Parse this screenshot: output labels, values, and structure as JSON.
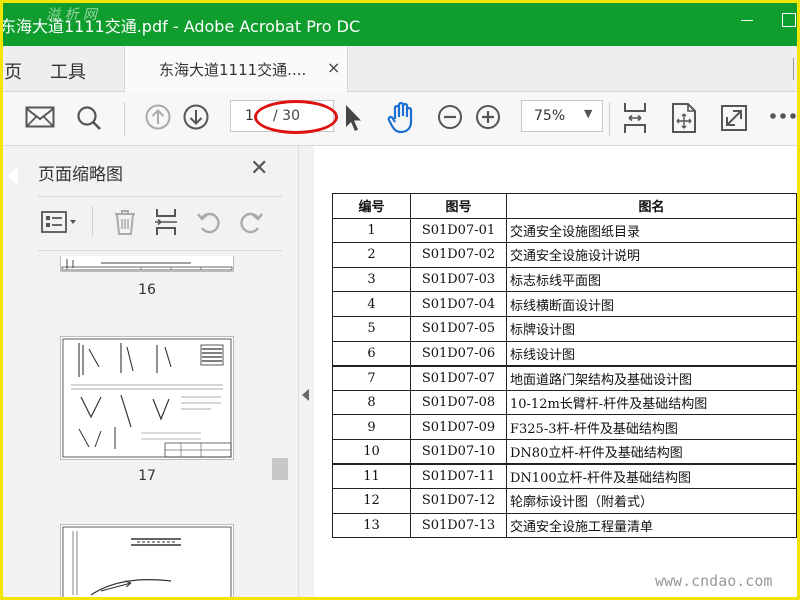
{
  "window": {
    "title": "东海大道1111交通.pdf - Adobe Acrobat Pro DC",
    "watermark": "溢 析 网"
  },
  "menu": {
    "home_label": "页",
    "tools_label": "工具"
  },
  "tab": {
    "label": "东海大道1111交通....",
    "close_glyph": "×"
  },
  "toolbar": {
    "page_current": "1",
    "page_total": "/ 30",
    "zoom": "75%",
    "zoom_arrow": "▼"
  },
  "panel": {
    "title": "页面缩略图",
    "close_glyph": "✕",
    "thumbnails": [
      {
        "number": "16"
      },
      {
        "number": "17"
      },
      {
        "number": ""
      }
    ]
  },
  "document": {
    "headers": [
      "编号",
      "图号",
      "图名"
    ],
    "rows": [
      [
        "1",
        "S01D07-01",
        "交通安全设施图纸目录"
      ],
      [
        "2",
        "S01D07-02",
        "交通安全设施设计说明"
      ],
      [
        "3",
        "S01D07-03",
        "标志标线平面图"
      ],
      [
        "4",
        "S01D07-04",
        "标线横断面设计图"
      ],
      [
        "5",
        "S01D07-05",
        "标牌设计图"
      ],
      [
        "6",
        "S01D07-06",
        "标线设计图"
      ],
      [
        "7",
        "S01D07-07",
        "地面道路门架结构及基础设计图"
      ],
      [
        "8",
        "S01D07-08",
        "10-12m长臂杆-杆件及基础结构图"
      ],
      [
        "9",
        "S01D07-09",
        "F325-3杆-杆件及基础结构图"
      ],
      [
        "10",
        "S01D07-10",
        "DN80立杆-杆件及基础结构图"
      ],
      [
        "11",
        "S01D07-11",
        "DN100立杆-杆件及基础结构图"
      ],
      [
        "12",
        "S01D07-12",
        "轮廓标设计图（附着式）"
      ],
      [
        "13",
        "S01D07-13",
        "交通安全设施工程量清单"
      ]
    ]
  },
  "footer_watermark": "www.cndao.com",
  "colors": {
    "titlebar": "#0f9e2e",
    "frame": "#f2e600",
    "annotation": "#e01010",
    "hand_tool": "#1a6fd0"
  }
}
